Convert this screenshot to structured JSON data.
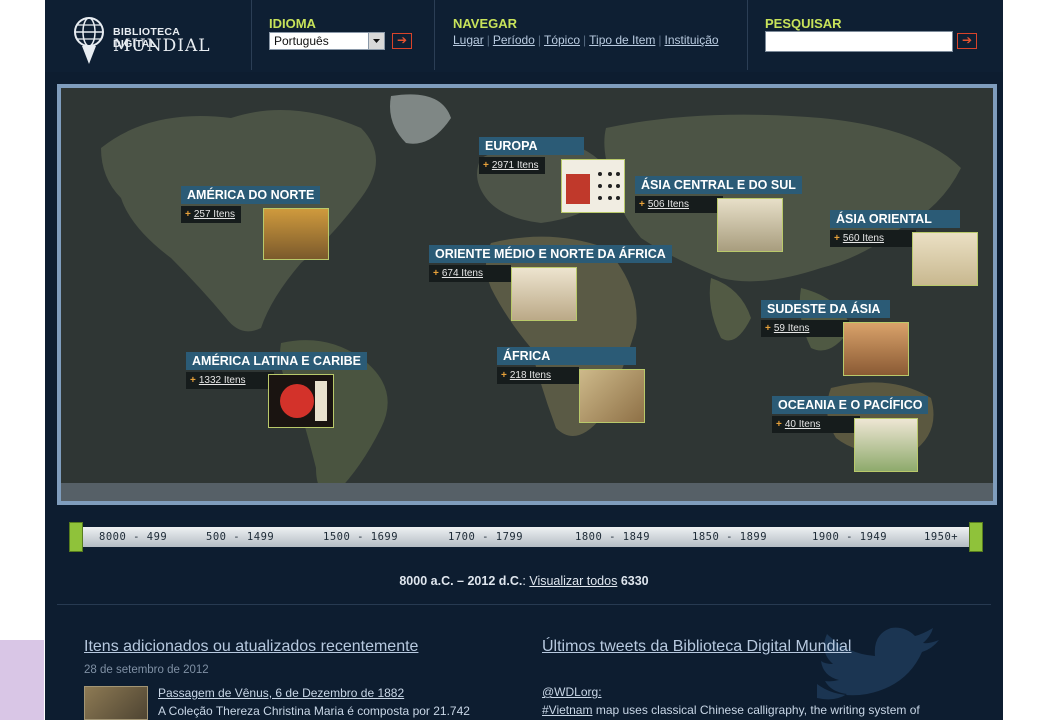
{
  "logo": {
    "line1": "BIBLIOTECA DIGITAL",
    "line2": "MUNDIAL"
  },
  "header": {
    "idioma_label": "IDIOMA",
    "idioma_value": "Português",
    "go_glyph": "➔",
    "navegar_label": "NAVEGAR",
    "nav_links": [
      "Lugar",
      "Período",
      "Tópico",
      "Tipo de Item",
      "Instituição"
    ],
    "pesquisar_label": "PESQUISAR",
    "search_value": ""
  },
  "regions": [
    {
      "name": "AMÉRICA DO NORTE",
      "count": "257 Itens"
    },
    {
      "name": "EUROPA",
      "count": "2971 Itens"
    },
    {
      "name": "ÁSIA CENTRAL E DO SUL",
      "count": "506 Itens"
    },
    {
      "name": "ÁSIA ORIENTAL",
      "count": "560 Itens"
    },
    {
      "name": "ORIENTE MÉDIO E NORTE DA ÁFRICA",
      "count": "674 Itens"
    },
    {
      "name": "SUDESTE DA ÁSIA",
      "count": "59 Itens"
    },
    {
      "name": "AMÉRICA LATINA E CARIBE",
      "count": "1332 Itens"
    },
    {
      "name": "ÁFRICA",
      "count": "218 Itens"
    },
    {
      "name": "OCEANIA E O PACÍFICO",
      "count": "40 Itens"
    }
  ],
  "timeline": [
    "8000 - 499",
    "500 - 1499",
    "1500 - 1699",
    "1700 - 1799",
    "1800 - 1849",
    "1850 - 1899",
    "1900 - 1949",
    "1950+"
  ],
  "range": {
    "span": "8000 a.C. – 2012 d.C.",
    "sep": ":",
    "view_all": "Visualizar todos",
    "total": "6330"
  },
  "recent": {
    "title": "Itens adicionados ou atualizados recentemente",
    "date": "28 de setembro de 2012",
    "item_title": "Passagem de Vênus, 6 de Dezembro de 1882",
    "item_desc": "A Coleção Thereza Christina Maria é composta por 21.742"
  },
  "tweets": {
    "title": "Últimos tweets da Biblioteca Digital Mundial",
    "handle": "@WDLorg:",
    "hashtag": "#Vietnam",
    "text": " map uses classical Chinese calligraphy, the writing system of"
  },
  "colors": {
    "page_bg": "#0d1d30",
    "accent_green": "#c8e35a",
    "region_title_bg": "#2b5b76",
    "arrow_red": "#e8532f"
  }
}
